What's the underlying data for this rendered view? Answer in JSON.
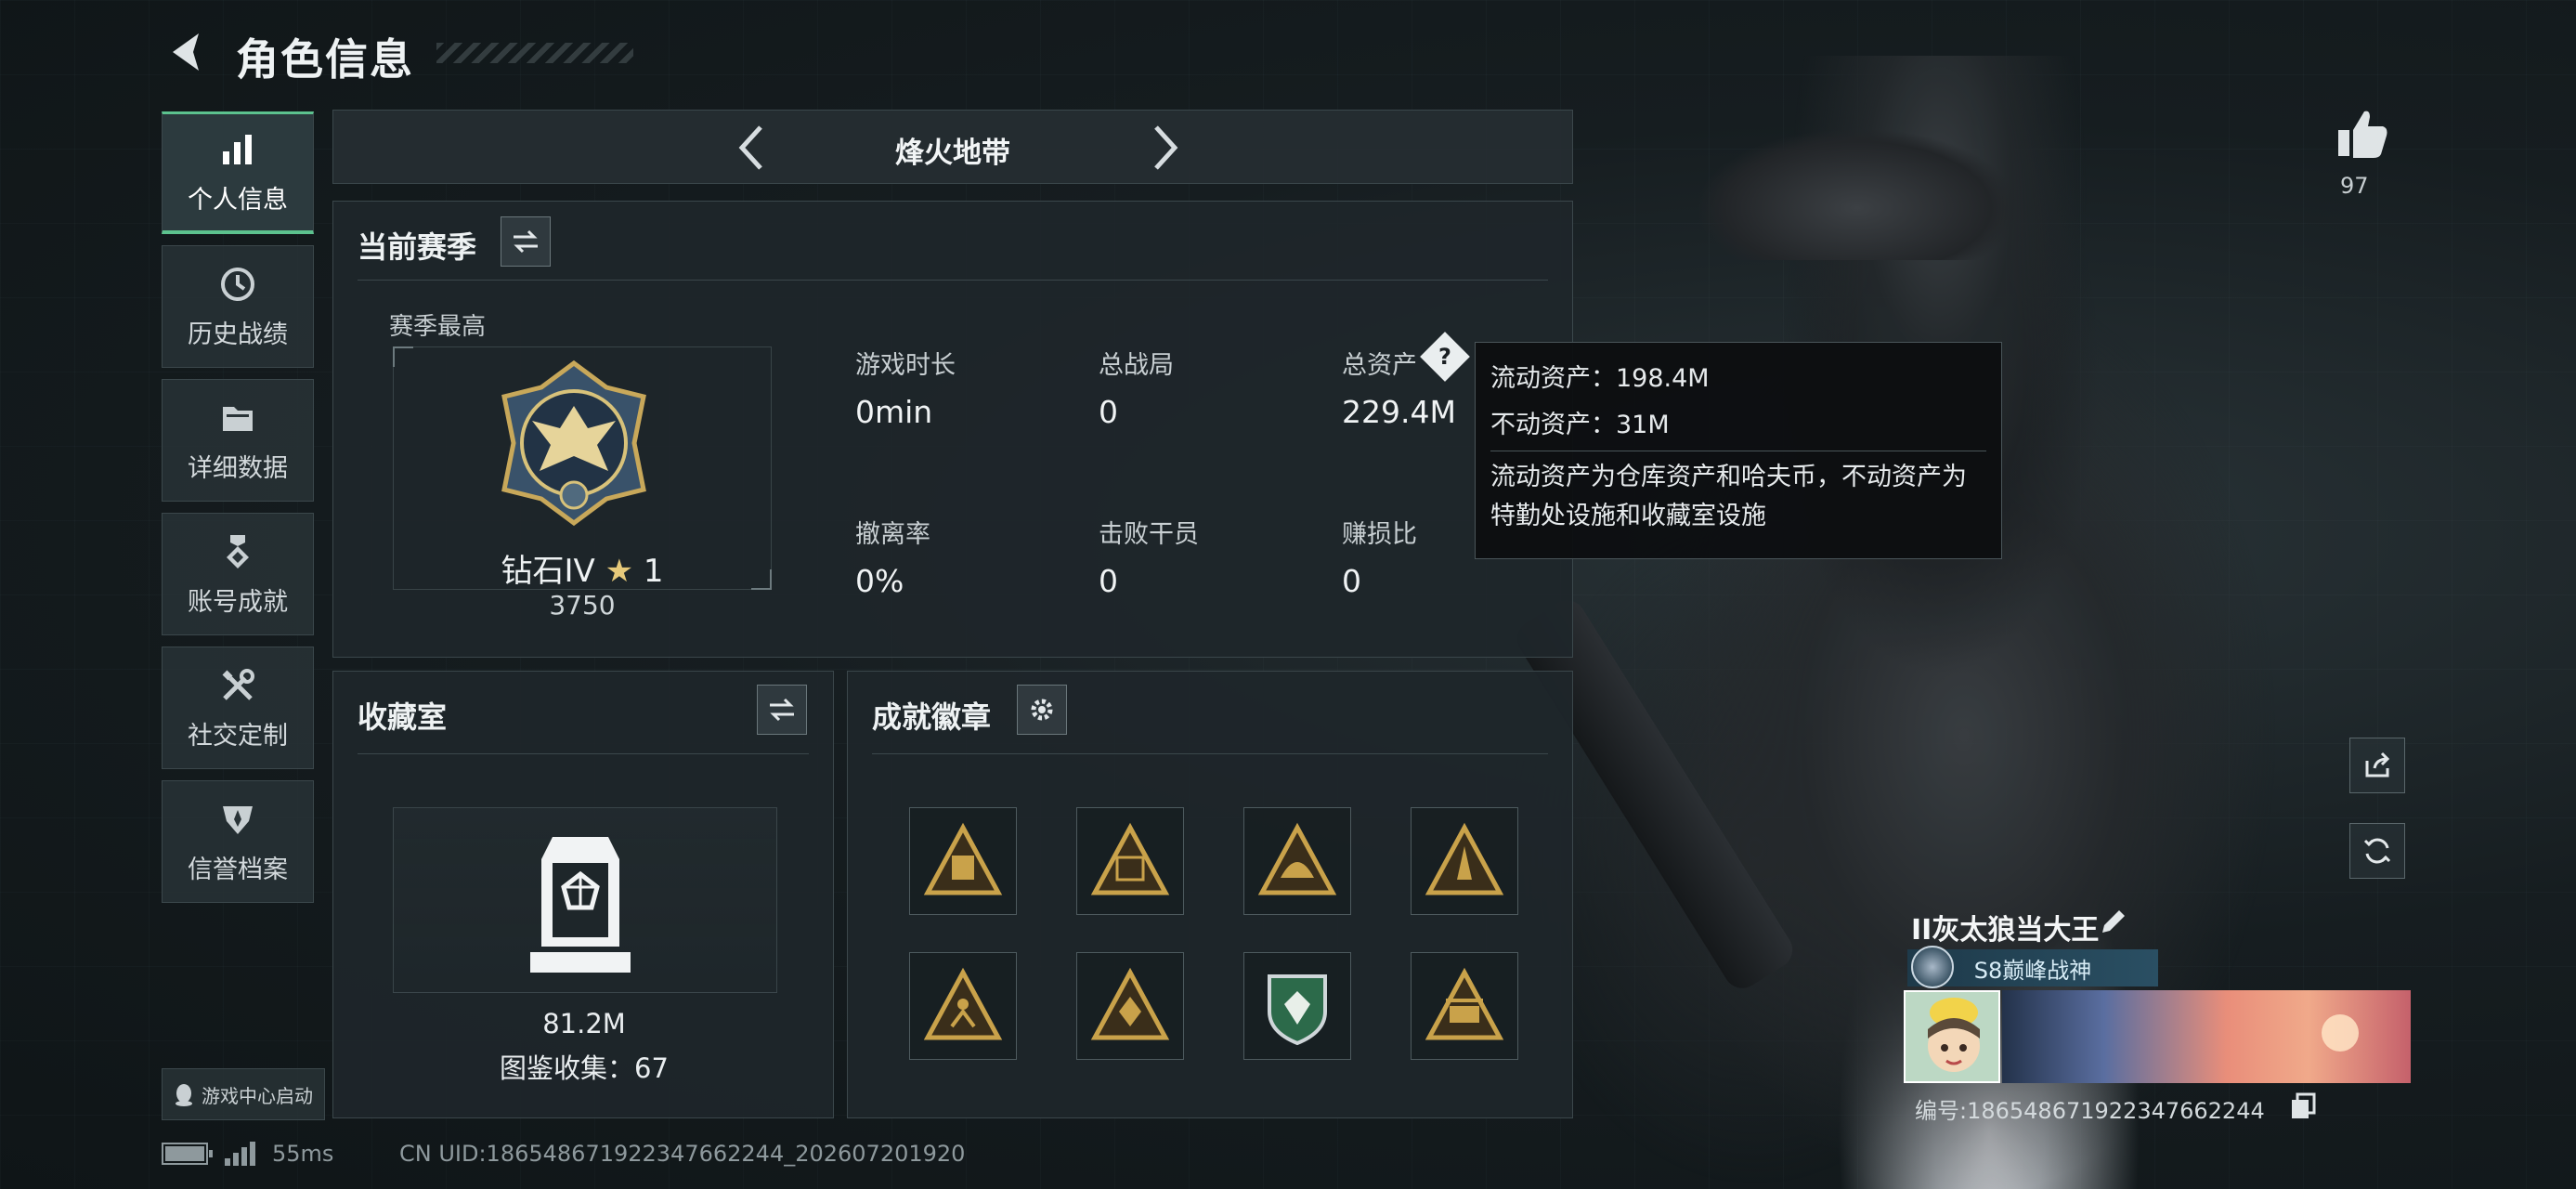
{
  "header": {
    "back_icon": "back-arrow-icon",
    "title": "角色信息"
  },
  "sidebar": {
    "items": [
      {
        "label": "个人信息",
        "icon": "bar-chart-icon",
        "active": true
      },
      {
        "label": "历史战绩",
        "icon": "history-clock-icon",
        "active": false
      },
      {
        "label": "详细数据",
        "icon": "folder-icon",
        "active": false
      },
      {
        "label": "账号成就",
        "icon": "achievement-medal-icon",
        "active": false
      },
      {
        "label": "社交定制",
        "icon": "wrench-tools-icon",
        "active": false
      },
      {
        "label": "信誉档案",
        "icon": "credibility-emblem-icon",
        "active": false
      }
    ],
    "launch_label": "游戏中心启动"
  },
  "status_bar": {
    "ping": "55ms",
    "uid": "CN UID:1865486719223476622​44_202607201920"
  },
  "mode": {
    "title": "烽火地带"
  },
  "season": {
    "title": "当前赛季",
    "subtitle": "赛季最高",
    "rank_name": "钻石IV",
    "rank_star": "★",
    "rank_stars": "1",
    "rank_score": "3750",
    "stats": {
      "playtime": {
        "label": "游戏时长",
        "value": "0min"
      },
      "matches": {
        "label": "总战局",
        "value": "0"
      },
      "assets": {
        "label": "总资产",
        "value": "229.4M"
      },
      "extract_rate": {
        "label": "撤离率",
        "value": "0%"
      },
      "kills": {
        "label": "击败干员",
        "value": "0"
      },
      "profit_ratio": {
        "label": "赚损比",
        "value": "0"
      }
    }
  },
  "tooltip": {
    "liquid": "流动资产：198.4M",
    "fixed": "不动资产：31M",
    "desc": "流动资产为仓库资产和哈夫币，不动资产为特勤处设施和收藏室设施"
  },
  "collection": {
    "title": "收藏室",
    "value": "81.2M",
    "count": "图鉴收集：67"
  },
  "badges": {
    "title": "成就徽章"
  },
  "player": {
    "likes": "97",
    "name": "II灰太狼当大王",
    "title_badge": "S8巅峰战神",
    "id": "编号:1865486719223476622​44"
  },
  "colors": {
    "accent_green": "#5cc28e",
    "gold": "#c9a24a",
    "panel_bg": "#1e262a"
  }
}
